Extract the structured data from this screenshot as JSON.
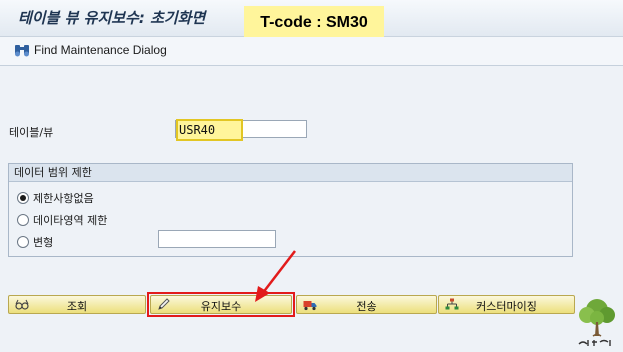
{
  "header": {
    "title": "테이블 뷰 유지보수: 초기화면",
    "tcode_annotation": "T-code : SM30"
  },
  "toolbar": {
    "find_dialog_label": "Find Maintenance Dialog"
  },
  "form": {
    "table_view_label": "테이블/뷰",
    "table_view_value": "USR40"
  },
  "restriction_group": {
    "title": "데이터 범위 제한",
    "options": [
      {
        "label": "제한사항없음",
        "selected": true
      },
      {
        "label": "데이타영역 제한",
        "selected": false
      },
      {
        "label": "변형",
        "selected": false
      }
    ],
    "variant_value": ""
  },
  "buttons": {
    "display": "조회",
    "maintain": "유지보수",
    "transport": "전송",
    "customizing": "커스터마이징"
  },
  "watermark": {
    "text": "느티나무"
  },
  "colors": {
    "highlight_yellow": "#fff59b",
    "annotation_red": "#e21b1b",
    "button_gradient_top": "#fbf8dc",
    "button_gradient_bottom": "#ecdf7c"
  }
}
